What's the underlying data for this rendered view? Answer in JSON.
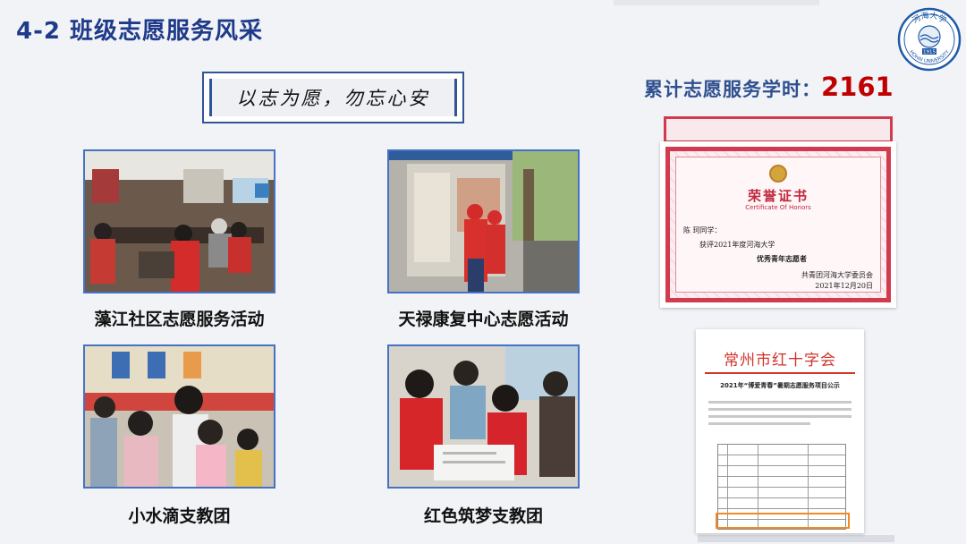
{
  "slide": {
    "title": "4-2 班级志愿服务风采",
    "motto": "以志为愿，勿忘心安"
  },
  "logo": {
    "name": "河海大学",
    "name_en": "HOHAI UNIVERSITY",
    "year": "1915"
  },
  "photos": [
    {
      "caption": "藻江社区志愿服务活动"
    },
    {
      "caption": "天禄康复中心志愿活动"
    },
    {
      "caption": "小水滴支教团"
    },
    {
      "caption": "红色筑梦支教团"
    }
  ],
  "stats": {
    "label": "累计志愿服务学时：",
    "value": "2161"
  },
  "certificate": {
    "title": "荣誉证书",
    "subtitle": "Certificate Of Honors",
    "recipient": "陈 珂同学：",
    "line1": "获评2021年度河海大学",
    "line2": "优秀青年志愿者",
    "issuer": "共青团河海大学委员会",
    "date": "2021年12月20日"
  },
  "notice": {
    "header": "常州市红十字会",
    "subtitle": "2021年“博爱青春”暑期志愿服务项目公示"
  },
  "colors": {
    "title_blue": "#1e3a8a",
    "frame_blue": "#4472c4",
    "accent_red": "#c00000",
    "highlight_orange": "#f08a24"
  }
}
